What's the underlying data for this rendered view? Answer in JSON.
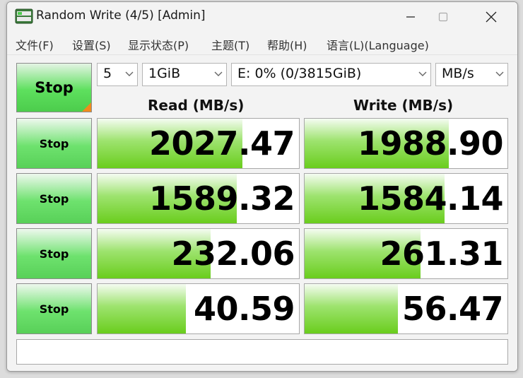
{
  "window": {
    "title": "Random Write (4/5) [Admin]",
    "icon": "disk-icon"
  },
  "menu": [
    "文件(F)",
    "设置(S)",
    "显示状态(P)",
    "主题(T)",
    "帮助(H)",
    "语言(L)(Language)"
  ],
  "toolbar": {
    "all_button_label": "Stop",
    "count": "5",
    "size": "1GiB",
    "drive": "E: 0% (0/3815GiB)",
    "unit": "MB/s"
  },
  "headers": {
    "read": "Read (MB/s)",
    "write": "Write (MB/s)"
  },
  "rows": [
    {
      "button": "Stop",
      "read": "2027.47",
      "read_fraction": 0.72,
      "write": "1988.90",
      "write_fraction": 0.71
    },
    {
      "button": "Stop",
      "read": "1589.32",
      "read_fraction": 0.69,
      "write": "1584.14",
      "write_fraction": 0.69
    },
    {
      "button": "Stop",
      "read": "232.06",
      "read_fraction": 0.56,
      "write": "261.31",
      "write_fraction": 0.57
    },
    {
      "button": "Stop",
      "read": "40.59",
      "read_fraction": 0.44,
      "write": "56.47",
      "write_fraction": 0.46
    }
  ],
  "comment": "",
  "colors": {
    "accent": "#6acd1d",
    "button_green": "#5ee05e",
    "corner_orange": "#f08a1c"
  }
}
